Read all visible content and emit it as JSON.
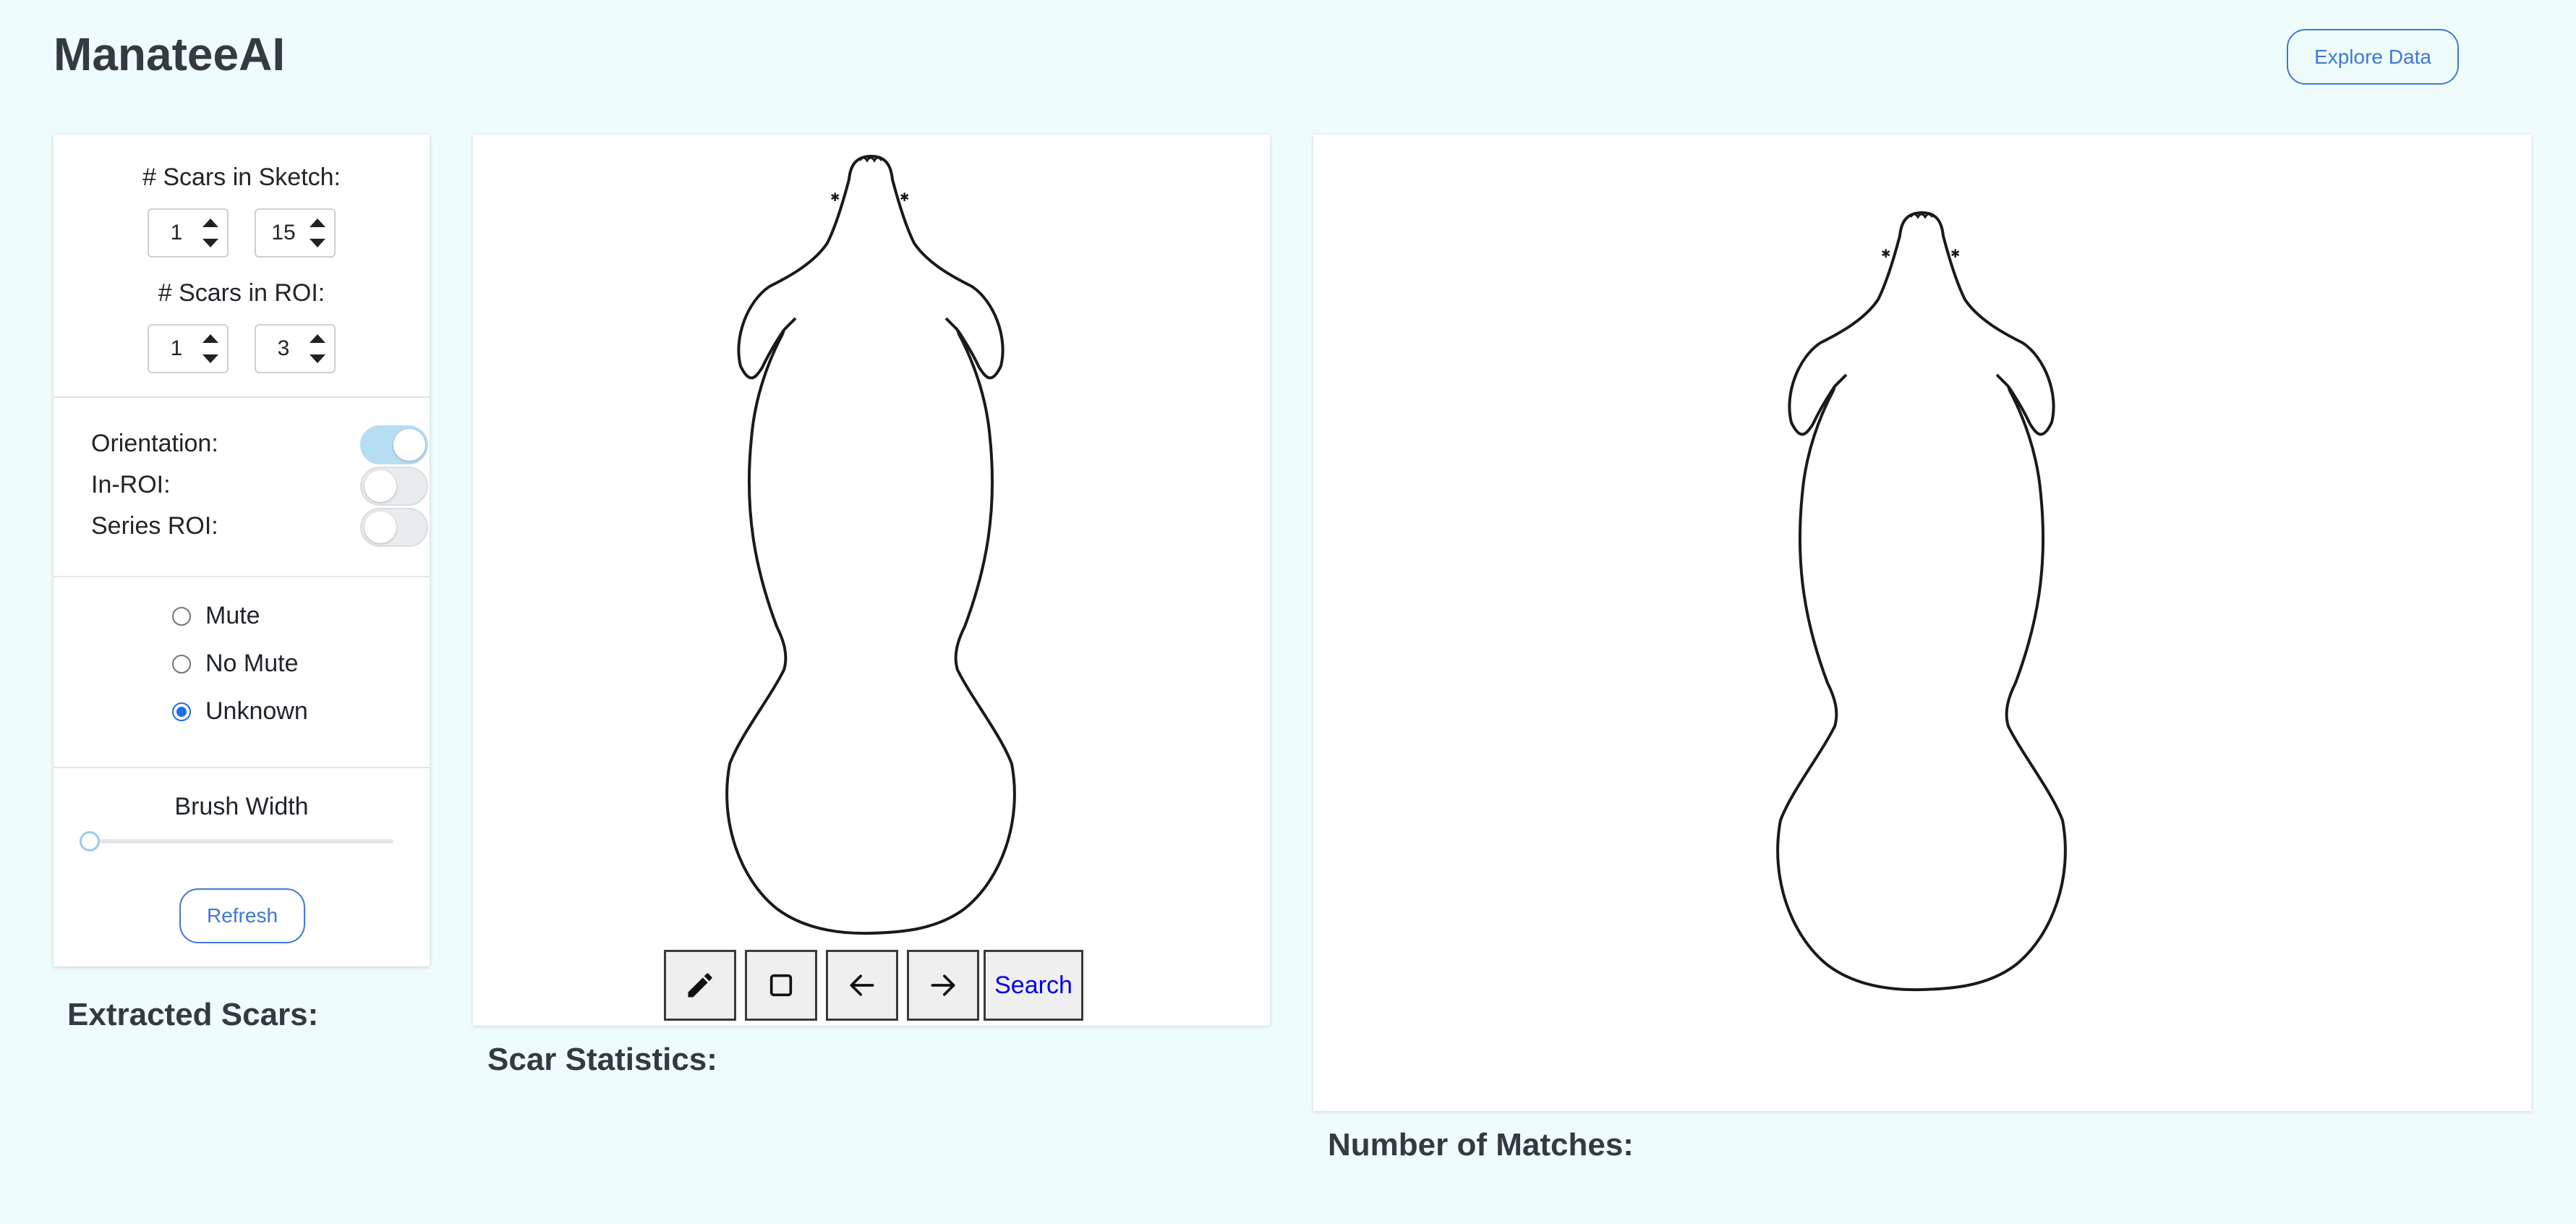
{
  "app": {
    "title": "ManateeAI"
  },
  "header": {
    "explore_button": "Explore Data"
  },
  "panel": {
    "scars_in_sketch": {
      "label": "# Scars in Sketch:",
      "min": "1",
      "max": "15"
    },
    "scars_in_roi": {
      "label": "# Scars in ROI:",
      "min": "1",
      "max": "3"
    },
    "toggles": [
      {
        "label": "Orientation:",
        "on": true
      },
      {
        "label": "In-ROI:",
        "on": false
      },
      {
        "label": "Series ROI:",
        "on": false
      }
    ],
    "mute_options": [
      {
        "label": "Mute",
        "checked": false
      },
      {
        "label": "No Mute",
        "checked": false
      },
      {
        "label": "Unknown",
        "checked": true
      }
    ],
    "brush": {
      "label": "Brush Width",
      "value": 0
    },
    "refresh_button": "Refresh"
  },
  "sections": {
    "extracted_scars": "Extracted Scars:",
    "scar_statistics": "Scar Statistics:",
    "number_of_matches": "Number of Matches:"
  },
  "toolbar": {
    "icons": [
      "pencil-icon",
      "square-icon",
      "arrow-left-icon",
      "arrow-right-icon"
    ],
    "search_label": "Search"
  },
  "colors": {
    "background": "#effcfc",
    "accent": "#3f78d6",
    "toggle_on": "#b7ddf3",
    "radio_checked": "#1e6ee8",
    "link": "#0000ee"
  }
}
